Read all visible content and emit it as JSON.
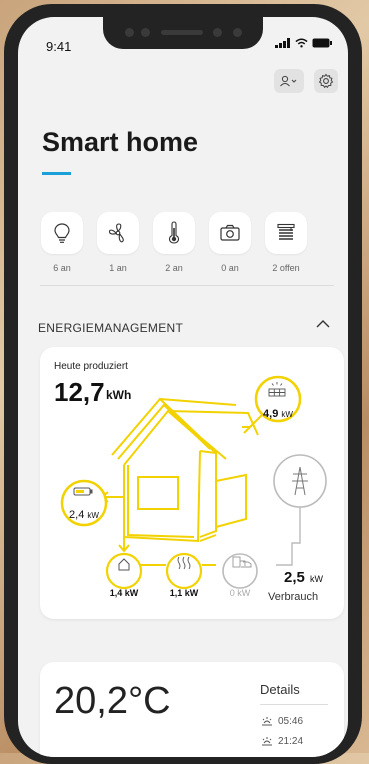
{
  "status_bar": {
    "time": "9:41"
  },
  "header": {
    "title": "Smart home"
  },
  "devices": [
    {
      "icon": "lightbulb-icon",
      "label": "6 an"
    },
    {
      "icon": "fan-icon",
      "label": "1 an"
    },
    {
      "icon": "thermometer-icon",
      "label": "2 an"
    },
    {
      "icon": "camera-icon",
      "label": "0 an"
    },
    {
      "icon": "blinds-icon",
      "label": "2 offen"
    }
  ],
  "energy": {
    "section_title": "ENERGIEMANAGEMENT",
    "produced_label": "Heute produziert",
    "produced_value": "12,7",
    "produced_unit": "kWh",
    "solar": {
      "value": "4,9",
      "unit": "kW"
    },
    "battery": {
      "value": "2,4",
      "unit": "kW"
    },
    "home": {
      "value": "1,4 kW"
    },
    "heating": {
      "value": "1,1 kW"
    },
    "car": {
      "value": "0 kW"
    },
    "consumption": {
      "value": "2,5",
      "unit": "kW",
      "label": "Verbrauch"
    }
  },
  "climate": {
    "temperature": "20,2°C",
    "details_label": "Details",
    "sunrise": "05:46",
    "sunset": "21:24"
  },
  "colors": {
    "accent": "#1aa0d9",
    "flow": "#f2d200"
  }
}
